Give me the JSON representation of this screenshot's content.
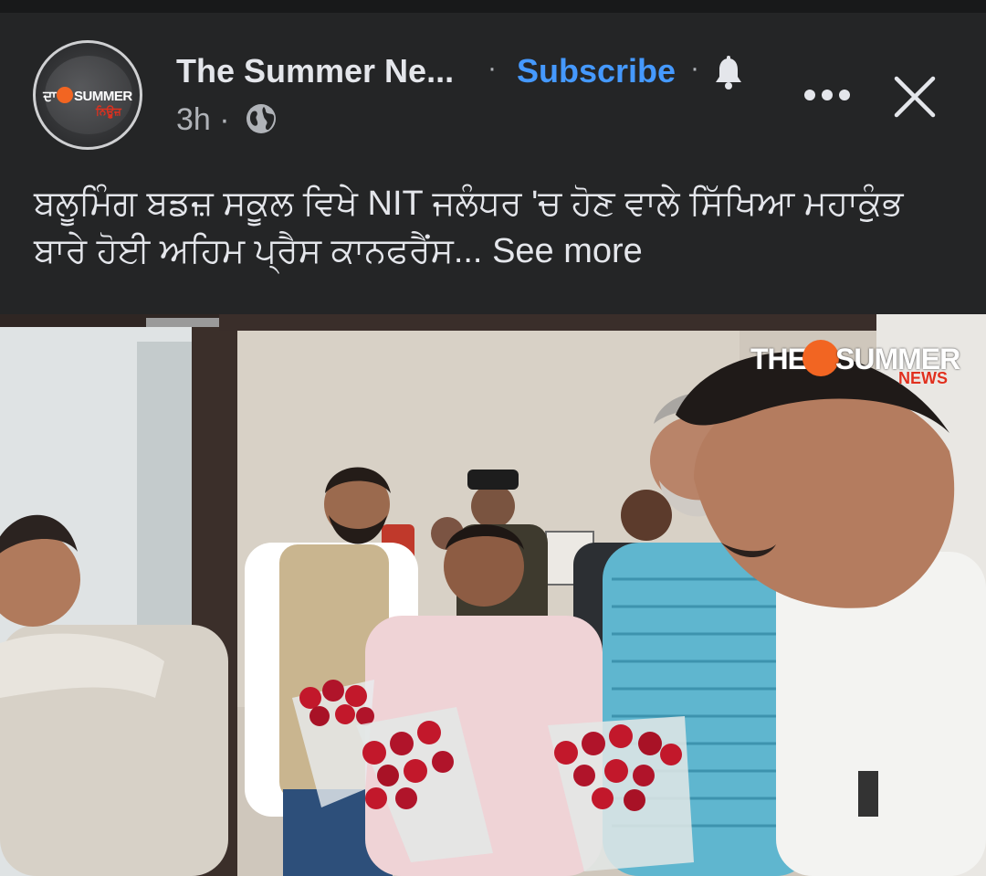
{
  "post": {
    "page_name": "The Summer Ne...",
    "subscribe_label": "Subscribe",
    "time_ago": "3h",
    "separator": "·",
    "caption": "ਬਲੂਮਿੰਗ ਬਡਜ਼ ਸਕੂਲ ਵਿਖੇ NIT ਜਲੰਧਰ 'ਚ ਹੋਣ ਵਾਲੇ ਸਿੱਖਿਆ ਮਹਾਕੁੰਭ ਬਾਰੇ ਹੋਈ ਅਹਿਮ ਪ੍ਰੈਸ ਕਾਨਫਰੈਂਸ...",
    "see_more_label": "See more"
  },
  "avatar": {
    "logo_text_left": "ਦਾ",
    "logo_text_right": "SUMMER",
    "logo_sub": "ਨਿਊਜ਼"
  },
  "photo": {
    "watermark_left": "THE",
    "watermark_right": "SUMMER",
    "watermark_sub": "NEWS"
  },
  "icons": {
    "bell": "bell-icon",
    "globe": "globe-icon",
    "more": "more-icon",
    "close": "close-icon"
  },
  "colors": {
    "background": "#242526",
    "text": "#e4e6eb",
    "secondary_text": "#b0b3b8",
    "subscribe": "#4599ff",
    "brand_orange": "#f26522",
    "brand_red": "#e0301e"
  }
}
